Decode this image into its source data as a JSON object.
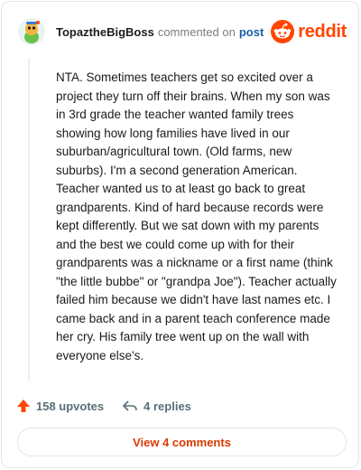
{
  "header": {
    "username": "TopaztheBigBoss",
    "commented_text": "commented on",
    "post_link": "post",
    "brand": "reddit"
  },
  "comment": {
    "text": "NTA. Sometimes teachers get so excited over a project they turn off their brains. When my son was in 3rd grade the teacher wanted family trees showing how long families have lived in our suburban/agricultural town. (Old farms, new suburbs). I'm a second generation American. Teacher wanted us to at least go back to great grandparents. Kind of hard because records were kept differently. But we sat down with my parents and the best we could come up with for their grandparents was a nickname or a first name (think \"the little bubbe\" or \"grandpa Joe\"). Teacher actually failed him because we didn't have last names etc. I came back and in a parent teach conference made her cry. His family tree went up on the wall with everyone else's."
  },
  "actions": {
    "upvotes": "158 upvotes",
    "replies": "4 replies"
  },
  "view_comments_label": "View 4 comments",
  "colors": {
    "brand": "#ff4500",
    "link": "#1c5ea8",
    "muted": "#7c7c7c",
    "view_comments": "#d93a00"
  }
}
